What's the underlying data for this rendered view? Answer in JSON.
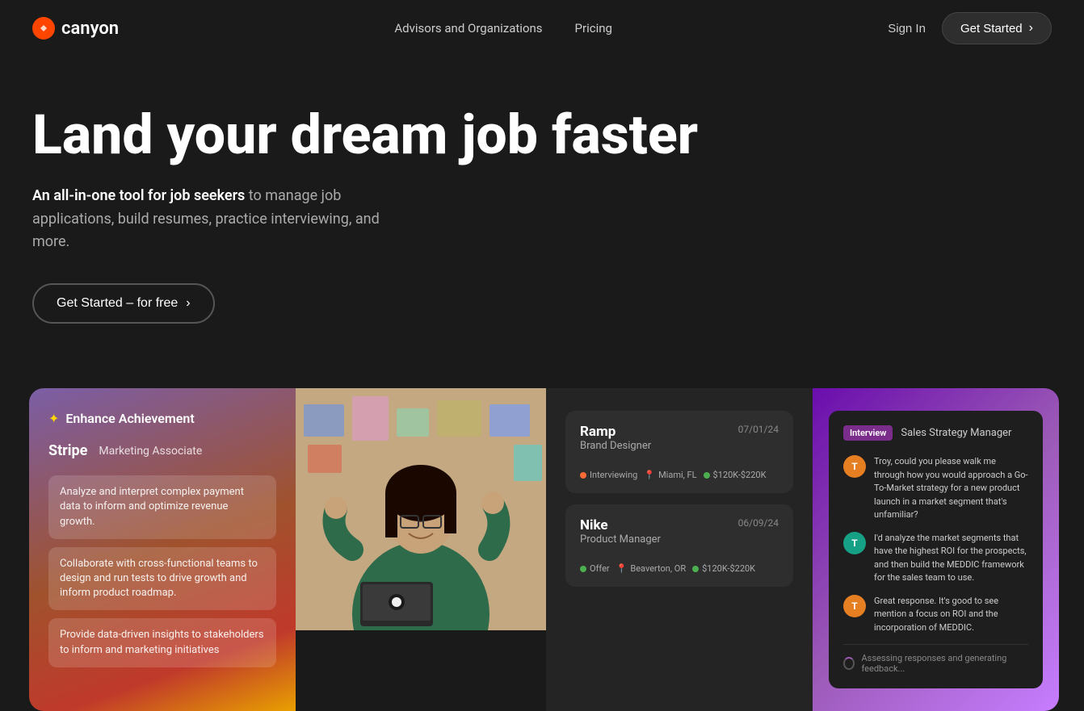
{
  "brand": {
    "logo_icon": "⬡",
    "logo_text": "canyon"
  },
  "nav": {
    "link1": "Advisors and Organizations",
    "link2": "Pricing",
    "sign_in": "Sign In",
    "get_started": "Get Started"
  },
  "hero": {
    "title": "Land your dream job faster",
    "subtitle_bold": "An all-in-one tool for job seekers",
    "subtitle_rest": " to manage job applications, build resumes, practice interviewing, and more.",
    "cta": "Get Started – for free"
  },
  "card1": {
    "header_icon": "✦",
    "header_title": "Enhance Achievement",
    "company": "Stripe",
    "role": "Marketing Associate",
    "bullets": [
      "Analyze and interpret complex payment data to inform and optimize revenue growth.",
      "Collaborate with cross-functional teams to design and run tests to drive growth and inform product roadmap.",
      "Provide data-driven insights to stakeholders to inform and marketing initiatives"
    ]
  },
  "card3": {
    "jobs": [
      {
        "company": "Ramp",
        "role": "Brand Designer",
        "date": "07/01/24",
        "tags": [
          {
            "dot": "orange",
            "label": "Interviewing"
          },
          {
            "dot": "none",
            "label": "📍 Miami, FL"
          },
          {
            "dot": "green",
            "label": "$120K-$220K"
          }
        ]
      },
      {
        "company": "Nike",
        "role": "Product Manager",
        "date": "06/09/24",
        "tags": [
          {
            "dot": "green",
            "label": "Offer"
          },
          {
            "dot": "none",
            "label": "📍 Beaverton, OR"
          },
          {
            "dot": "green",
            "label": "$120K-$220K"
          }
        ]
      }
    ]
  },
  "card4": {
    "label": "Interview",
    "role": "Sales Strategy Manager",
    "messages": [
      {
        "avatar_letter": "T",
        "avatar_color": "orange",
        "text": "Troy, could you please walk me through how you would approach a Go-To-Market strategy for a new product launch in a market segment that's unfamiliar?"
      },
      {
        "avatar_letter": "T",
        "avatar_color": "teal",
        "text": "I'd analyze the market segments that have the highest ROI for the prospects, and then build the MEDDIC framework for the sales team to use."
      },
      {
        "avatar_letter": "T",
        "avatar_color": "orange",
        "text": "Great response. It's good to see mention a focus on ROI and the incorporation of MEDDIC."
      }
    ],
    "generating_text": "Assessing responses and generating feedback..."
  }
}
